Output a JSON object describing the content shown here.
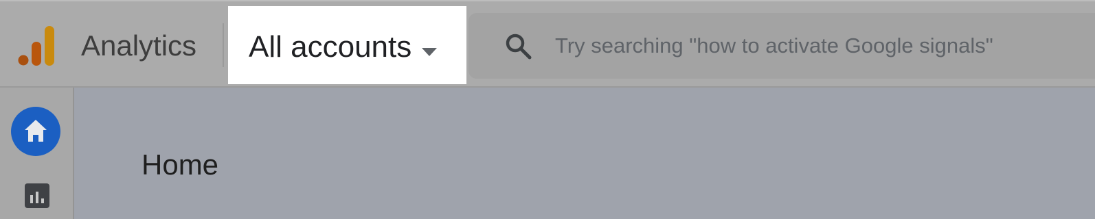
{
  "header": {
    "app_name": "Analytics",
    "account_selector": {
      "label": "All accounts"
    },
    "search": {
      "placeholder": "Try searching \"how to activate Google signals\""
    }
  },
  "sidenav": {
    "items": [
      {
        "name": "Home",
        "icon": "home-icon",
        "active": true
      },
      {
        "name": "Reports",
        "icon": "bar-chart-icon",
        "active": false
      }
    ]
  },
  "main": {
    "title": "Home"
  },
  "colors": {
    "logo_orange": "#e8710a",
    "logo_brown": "#a9500f",
    "home_active": "#1b5fc2"
  }
}
